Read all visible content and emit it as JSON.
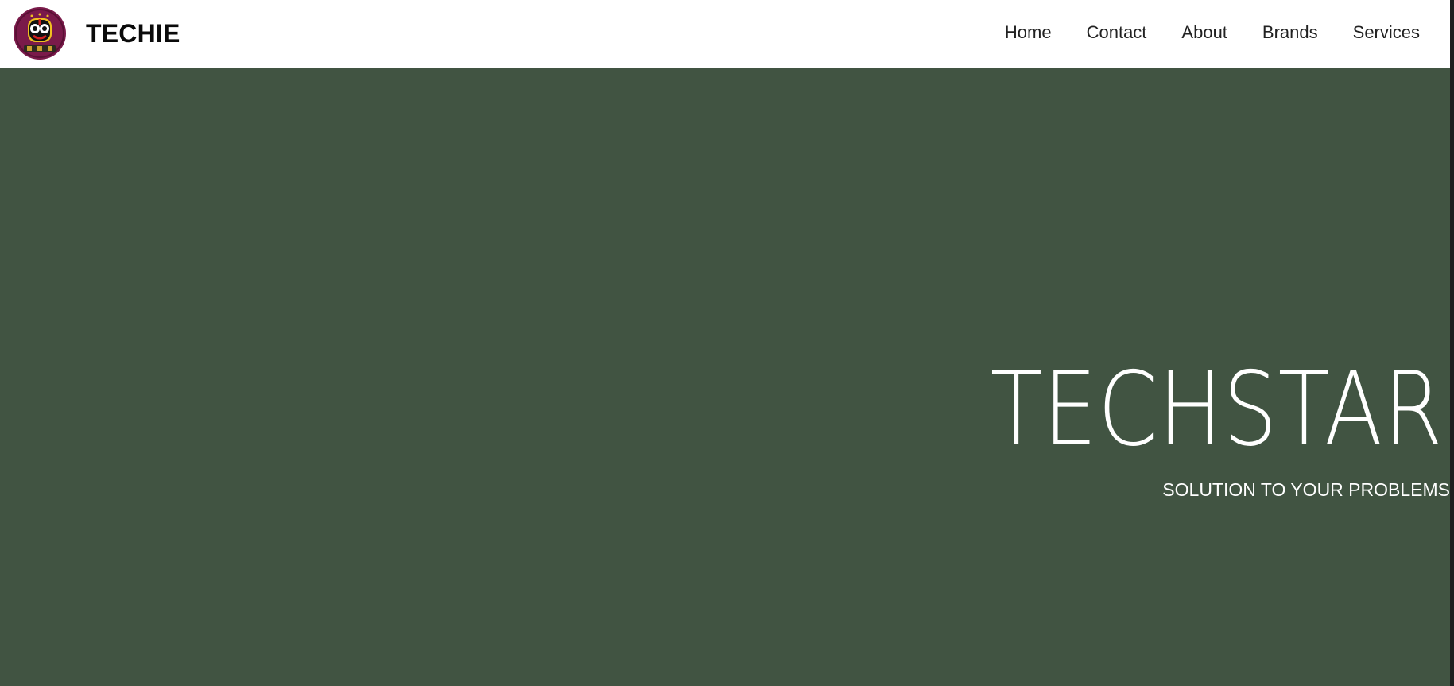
{
  "header": {
    "brand": "TECHIE",
    "logo_icon": "jagannath-face-logo",
    "nav": [
      {
        "label": "Home"
      },
      {
        "label": "Contact"
      },
      {
        "label": "About"
      },
      {
        "label": "Brands"
      },
      {
        "label": "Services"
      }
    ]
  },
  "hero": {
    "title": "TECHSTAR",
    "subtitle": "SOLUTION TO YOUR PROBLEMS"
  },
  "colors": {
    "hero_background": "#415442",
    "header_background": "#ffffff",
    "nav_text": "#222222",
    "hero_text": "#ffffff",
    "logo_circle": "#7a1a4a"
  }
}
